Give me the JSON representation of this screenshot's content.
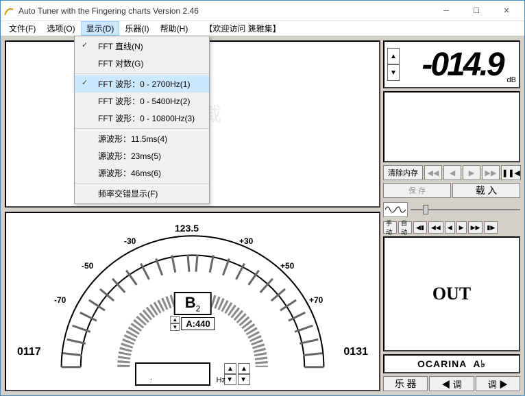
{
  "window": {
    "title": "Auto Tuner with the Fingering charts  Version 2.46"
  },
  "menubar": {
    "file": "文件(F)",
    "options": "选项(O)",
    "display": "显示(D)",
    "instrument": "乐器(I)",
    "help": "帮助(H)",
    "visit": "【欢迎访问 篪雅集】"
  },
  "dropdown": {
    "fft_line": "FFT 直线(N)",
    "fft_log": "FFT 对数(G)",
    "fft_wave1": "FFT 波形：0 - 2700Hz(1)",
    "fft_wave2": "FFT 波形：0 - 5400Hz(2)",
    "fft_wave3": "FFT 波形：0 - 10800Hz(3)",
    "src1": "源波形：11.5ms(4)",
    "src2": "源波形：23ms(5)",
    "src3": "源波形：46ms(6)",
    "freq_cross": "频率交错显示(F)"
  },
  "lcd": {
    "value": "-014.9",
    "unit": "dB"
  },
  "controls": {
    "clear_mem": "清除内存",
    "save": "保 存",
    "load": "载 入",
    "manual": "手 动",
    "auto": "自 动"
  },
  "out_label": "OUT",
  "instrument_name": "OCARINA",
  "instrument_key": "A♭",
  "bottom_buttons": {
    "instrument": "乐 器",
    "tune_left": "◀ 调",
    "tune_right": "调 ▶"
  },
  "gauge": {
    "top": "123.5",
    "m30": "-30",
    "p30": "+30",
    "m50": "-50",
    "p50": "+50",
    "m70": "-70",
    "p70": "+70",
    "left": "0117",
    "right": "0131",
    "note": "B",
    "note_oct": "2",
    "a_ref": "A:440",
    "hz": "Hz"
  }
}
